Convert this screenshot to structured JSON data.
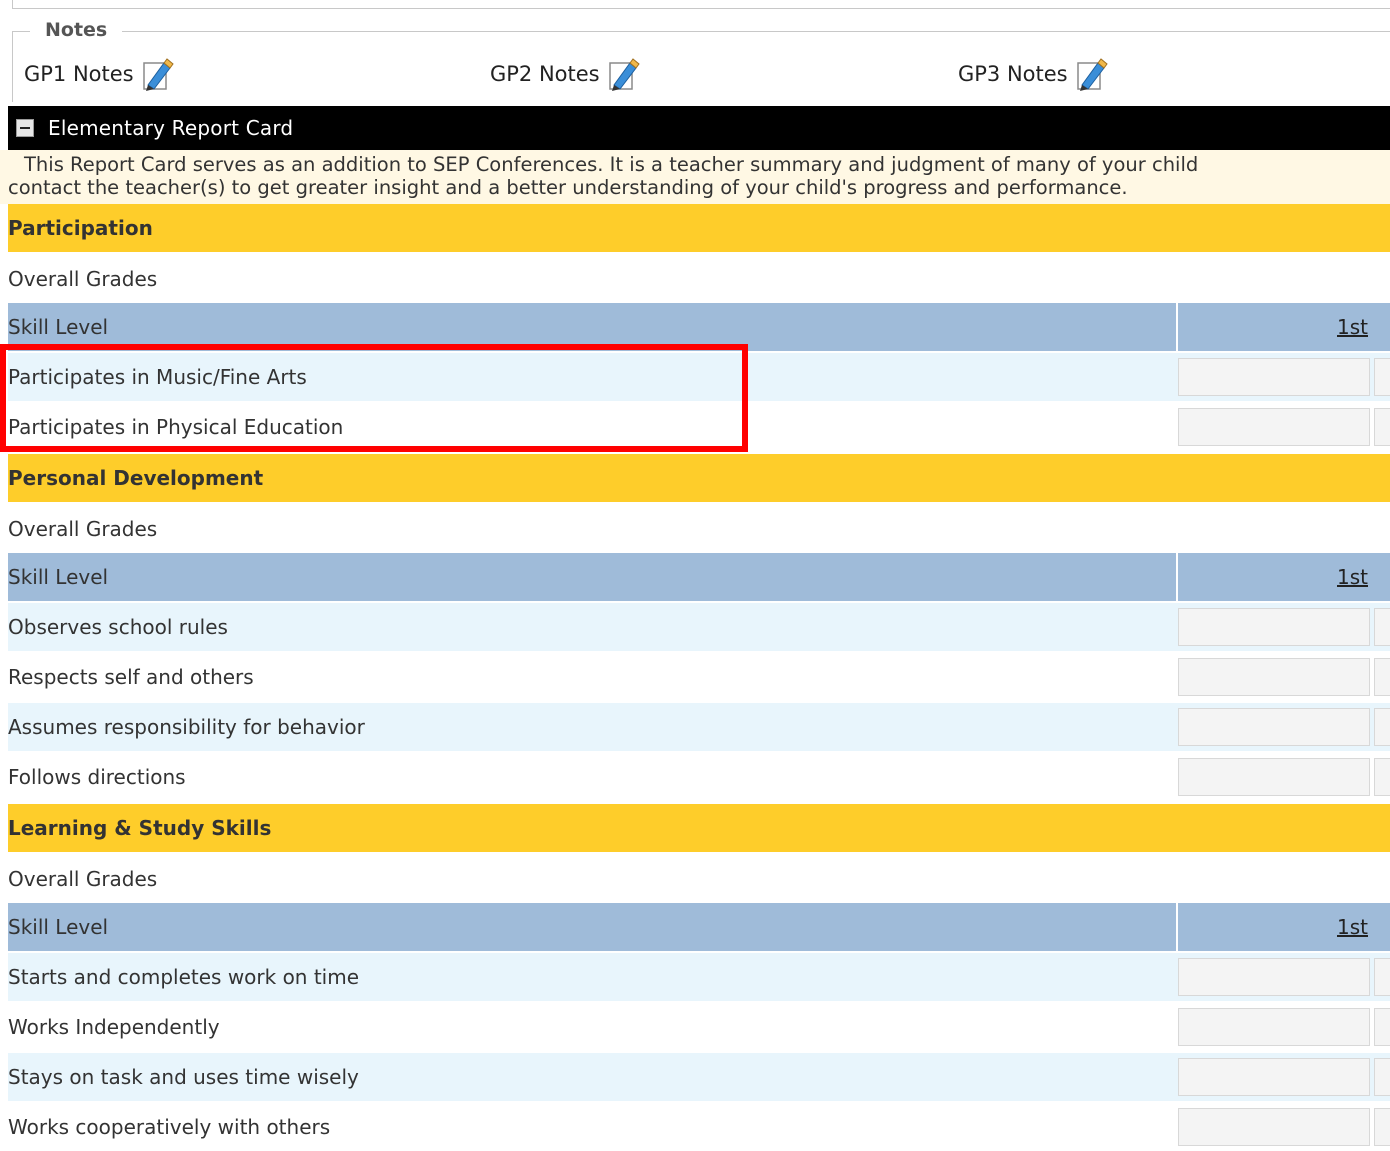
{
  "notes": {
    "legend": "Notes",
    "items": [
      {
        "label": "GP1 Notes",
        "icon": "edit-note-icon"
      },
      {
        "label": "GP2 Notes",
        "icon": "edit-note-icon"
      },
      {
        "label": "GP3 Notes",
        "icon": "edit-note-icon"
      }
    ]
  },
  "report_card": {
    "title": "Elementary Report Card",
    "intro_line1": "This Report Card serves as an addition to SEP Conferences. It is a teacher summary and judgment of many of your child",
    "intro_line2": "contact the teacher(s) to get greater insight and a better understanding of your child's progress and performance."
  },
  "sections": [
    {
      "title": "Participation",
      "overall_label": "Overall Grades",
      "skill_label": "Skill Level",
      "period_label": "1st",
      "items": [
        "Participates in Music/Fine Arts",
        "Participates in Physical Education"
      ]
    },
    {
      "title": "Personal Development",
      "overall_label": "Overall Grades",
      "skill_label": "Skill Level",
      "period_label": "1st",
      "items": [
        "Observes school rules",
        "Respects self and others",
        "Assumes responsibility for behavior",
        "Follows directions"
      ]
    },
    {
      "title": "Learning & Study Skills",
      "overall_label": "Overall Grades",
      "skill_label": "Skill Level",
      "period_label": "1st",
      "items": [
        "Starts and completes work on time",
        "Works Independently",
        "Stays on task and uses time wisely",
        "Works cooperatively with others"
      ]
    }
  ],
  "colors": {
    "section_header": "#fecd2a",
    "skill_header": "#9fbbd9",
    "item_row": "#e8f5fc",
    "highlight": "#ff0000"
  }
}
